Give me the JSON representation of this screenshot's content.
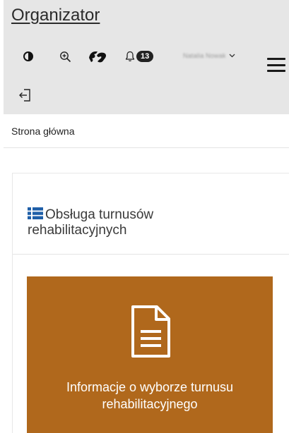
{
  "app": {
    "title": "Organizator"
  },
  "toolbar": {
    "contrast_icon": "contrast-icon",
    "zoom_icon": "zoom-in-icon",
    "sign_language_icon": "sign-language-icon",
    "notifications_icon": "bell-icon",
    "notification_count": "13",
    "user_name": "Natalia Nowak",
    "user_dropdown_icon": "chevron-down-icon",
    "menu_icon": "hamburger-icon",
    "logout_icon": "logout-icon"
  },
  "breadcrumb": {
    "label": "Strona główna"
  },
  "panel": {
    "title_icon": "list-icon",
    "title": "Obsługa turnusów rehabilitacyjnych"
  },
  "tiles": [
    {
      "icon": "document-icon",
      "label": "Informacje o wyborze turnusu rehabilitacyjnego",
      "color": "#b0681c"
    }
  ],
  "colors": {
    "topbar_bg": "#e6e6e6",
    "tile_bg": "#b0681c"
  }
}
